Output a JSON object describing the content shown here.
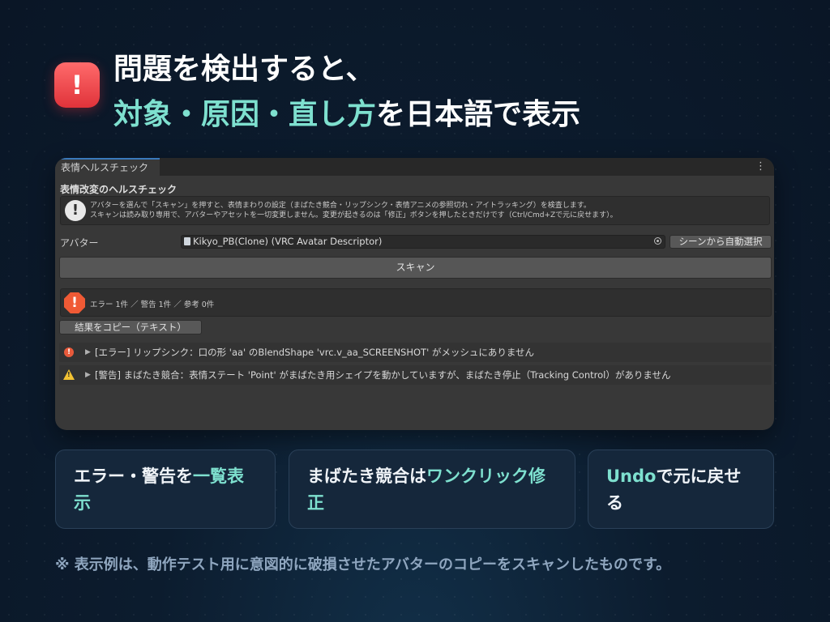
{
  "headline": {
    "line1": "問題を検出すると、",
    "line2_accent": "対象・原因・直し方",
    "line2_rest": "を日本語で表示",
    "badge": "!"
  },
  "window": {
    "tab_label": "表情ヘルスチェック",
    "menu_icon": "⋮",
    "section_title": "表情改変のヘルスチェック",
    "help_icon": "!",
    "help_line1": "アバターを選んで「スキャン」を押すと、表情まわりの設定（まばたき競合・リップシンク・表情アニメの参照切れ・アイトラッキング）を検査します。",
    "help_line2": "スキャンは読み取り専用で、アバターやアセットを一切変更しません。変更が起きるのは「修正」ボタンを押したときだけです（Ctrl/Cmd+Zで元に戻せます）。",
    "avatar_label": "アバター",
    "avatar_value": "Kikyo_PB(Clone) (VRC Avatar Descriptor)",
    "auto_select_label": "シーンから自動選択",
    "scan_label": "スキャン",
    "summary_icon": "!",
    "summary_text": "エラー 1件 ／ 警告 1件 ／ 参考 0件",
    "copy_label": "結果をコピー（テキスト）",
    "issues": [
      {
        "type": "error",
        "icon": "!",
        "arrow": "▶",
        "text": "[エラー] リップシンク：口の形 'aa' のBlendShape 'vrc.v_aa_SCREENSHOT' がメッシュにありません"
      },
      {
        "type": "warning",
        "icon": "!",
        "arrow": "▶",
        "text": "[警告] まばたき競合：表情ステート 'Point' がまばたき用シェイプを動かしていますが、まばたき停止（Tracking Control）がありません"
      }
    ]
  },
  "cards": [
    {
      "text": "エラー・警告を",
      "accent": "一覧表示",
      "text_after": ""
    },
    {
      "text": "まばたき競合は",
      "accent": "ワンクリック修正",
      "text_after": ""
    },
    {
      "text": "",
      "accent": "Undo",
      "text_after": "で元に戻せる"
    }
  ],
  "footnote": "※ 表示例は、動作テスト用に意図的に破損させたアバターのコピーをスキャンしたものです。",
  "colors": {
    "accent": "#7ee0cf",
    "error": "#f05a35",
    "warning": "#f2c233",
    "background": "#0c1c2e"
  }
}
